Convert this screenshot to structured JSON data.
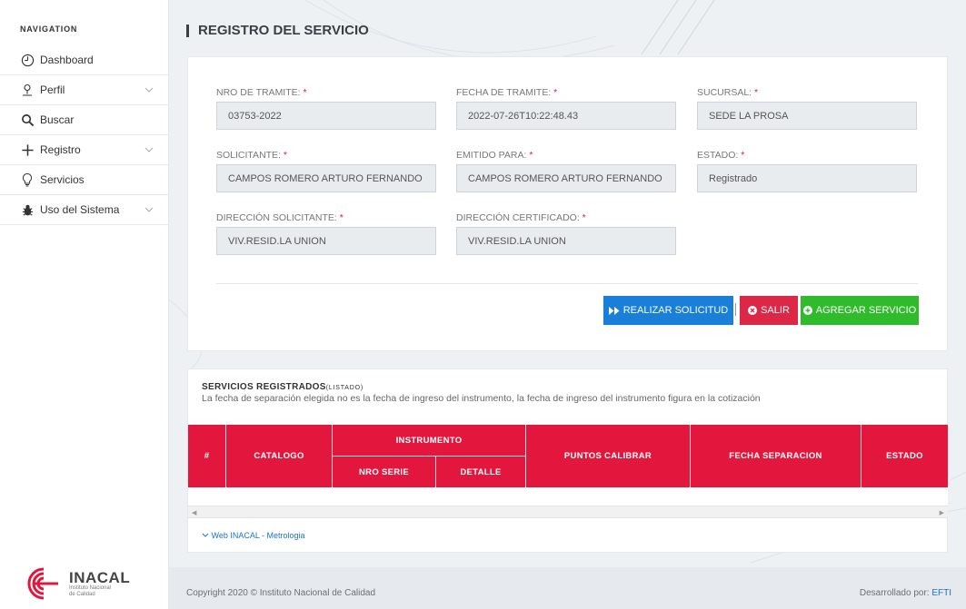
{
  "sidebar": {
    "header": "NAVIGATION",
    "items": [
      {
        "label": "Dashboard",
        "icon": "clock-icon",
        "has_submenu": false
      },
      {
        "label": "Perfil",
        "icon": "user-icon",
        "has_submenu": true
      },
      {
        "label": "Buscar",
        "icon": "search-icon",
        "has_submenu": false
      },
      {
        "label": "Registro",
        "icon": "plus-icon",
        "has_submenu": true
      },
      {
        "label": "Servicios",
        "icon": "lightbulb-icon",
        "has_submenu": false
      },
      {
        "label": "Uso del Sistema",
        "icon": "bug-icon",
        "has_submenu": true
      }
    ],
    "logo": {
      "name": "INACAL",
      "subtitle_line1": "Instituto Nacional",
      "subtitle_line2": "de Calidad"
    }
  },
  "page": {
    "title": "REGISTRO DEL SERVICIO"
  },
  "form": {
    "nro_tramite": {
      "label": "NRO DE TRAMITE:",
      "value": "03753-2022"
    },
    "fecha_tramite": {
      "label": "FECHA DE TRAMITE:",
      "value": "2022-07-26T10:22:48.43"
    },
    "sucursal": {
      "label": "SUCURSAL:",
      "value": "SEDE LA PROSA"
    },
    "solicitante": {
      "label": "SOLICITANTE:",
      "value": "CAMPOS ROMERO ARTURO FERNANDO"
    },
    "emitido_para": {
      "label": "EMITIDO PARA:",
      "value": "CAMPOS ROMERO ARTURO FERNANDO"
    },
    "estado": {
      "label": "ESTADO:",
      "value": "Registrado"
    },
    "direccion_solicitante": {
      "label": "DIRECCIÓN SOLICITANTE:",
      "value": "VIV.RESID.LA UNION"
    },
    "direccion_certificado": {
      "label": "DIRECCIÓN CERTIFICADO:",
      "value": "VIV.RESID.LA UNION"
    },
    "required_mark": "*"
  },
  "actions": {
    "realizar": "REALIZAR SOLICITUD",
    "separator": "|",
    "salir": "SALIR",
    "agregar": "AGREGAR SERVICIO"
  },
  "services": {
    "title": "SERVICIOS REGISTRADOS",
    "title_suffix": "(LISTADO)",
    "note": "La fecha de separación elegida no es la fecha de ingreso del instrumento, la fecha de ingreso del instrumento figura en la cotización",
    "columns": {
      "num": "#",
      "catalogo": "CATALOGO",
      "instrumento": "INSTRUMENTO",
      "nro_serie": "NRO SERIE",
      "detalle": "DETALLE",
      "puntos": "PUNTOS CALIBRAR",
      "fecha_sep": "FECHA SEPARACION",
      "estado": "ESTADO"
    },
    "rows": [],
    "link": "Web INACAL - Metrologia"
  },
  "footer": {
    "copyright": "Copyright 2020 © Instituto Nacional de Calidad",
    "dev_label": "Desarrollado por: ",
    "dev_name": "EFTI"
  },
  "colors": {
    "accent_red": "#e3173d",
    "btn_blue": "#1a7fd9",
    "btn_red": "#dc2746",
    "btn_green": "#2fbb2c",
    "link_blue": "#1a73c9"
  }
}
